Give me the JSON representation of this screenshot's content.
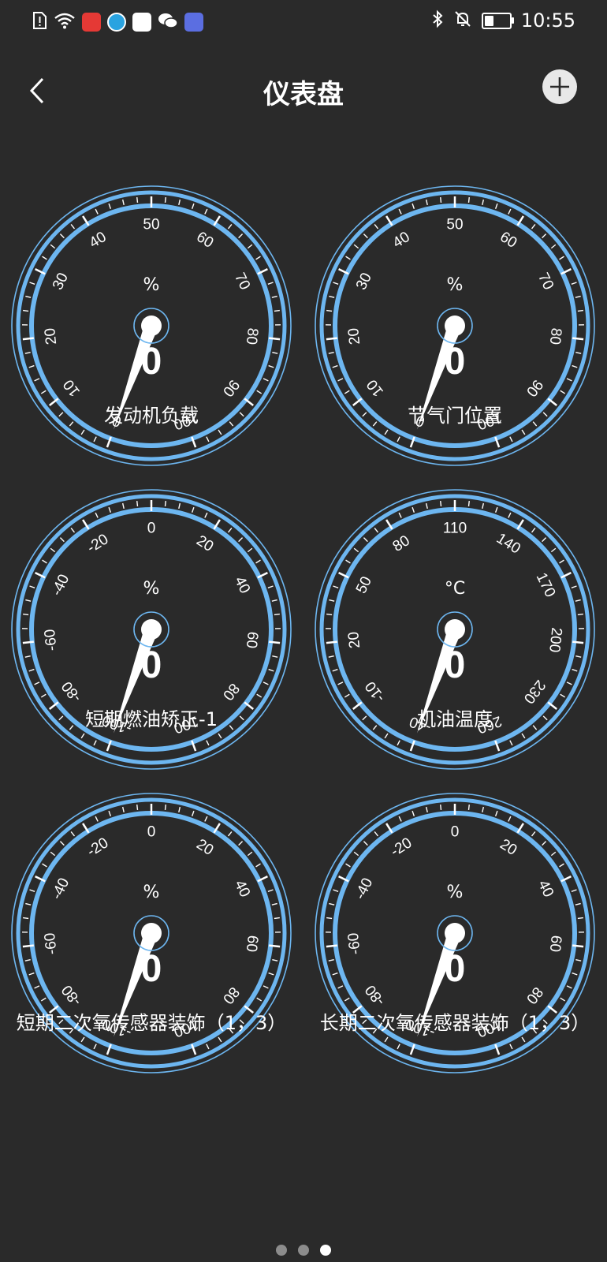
{
  "status_bar": {
    "time": "10:55",
    "battery_level": 0.35,
    "left_icons": [
      "sim-alert-icon",
      "wifi-icon",
      "huawei-app-icon",
      "browser-app-icon",
      "fm-app-icon",
      "wechat-icon",
      "music-app-icon"
    ],
    "right_icons": [
      "bluetooth-icon",
      "mute-bell-icon",
      "battery-icon"
    ]
  },
  "header": {
    "title": "仪表盘",
    "back_icon": "chevron-left-icon",
    "add_icon": "plus-icon"
  },
  "colors": {
    "background": "#2a2a2a",
    "gauge_ring": "#6db6f0",
    "needle": "#ffffff"
  },
  "gauges": [
    {
      "unit": "%",
      "value": "0",
      "label": "发动机负载",
      "min": 0,
      "max": 100,
      "ticks": [
        "0",
        "10",
        "20",
        "30",
        "40",
        "50",
        "60",
        "70",
        "80",
        "90",
        "100"
      ],
      "current": 0
    },
    {
      "unit": "%",
      "value": "0",
      "label": "节气门位置",
      "min": 0,
      "max": 100,
      "ticks": [
        "0",
        "10",
        "20",
        "30",
        "40",
        "50",
        "60",
        "70",
        "80",
        "90",
        "100"
      ],
      "current": 0
    },
    {
      "unit": "%",
      "value": "0",
      "label": "短期燃油矫正-1",
      "min": -100,
      "max": 100,
      "ticks": [
        "-100",
        "-80",
        "-60",
        "-40",
        "-20",
        "0",
        "20",
        "40",
        "60",
        "80",
        "100"
      ],
      "current": -100
    },
    {
      "unit": "°C",
      "value": "0",
      "label": "机油温度",
      "min": -40,
      "max": 260,
      "ticks": [
        "-40",
        "-10",
        "20",
        "50",
        "80",
        "110",
        "140",
        "170",
        "200",
        "230",
        "260"
      ],
      "current": -40
    },
    {
      "unit": "%",
      "value": "0",
      "label": "短期二次氧传感器装饰（1，3）",
      "min": -100,
      "max": 100,
      "ticks": [
        "-100",
        "-80",
        "-60",
        "-40",
        "-20",
        "0",
        "20",
        "40",
        "60",
        "80",
        "100"
      ],
      "current": -100
    },
    {
      "unit": "%",
      "value": "0",
      "label": "长期二次氧传感器装饰（1，3）",
      "min": -100,
      "max": 100,
      "ticks": [
        "-100",
        "-80",
        "-60",
        "-40",
        "-20",
        "0",
        "20",
        "40",
        "60",
        "80",
        "100"
      ],
      "current": -100
    }
  ],
  "pager": {
    "count": 3,
    "active": 2
  }
}
